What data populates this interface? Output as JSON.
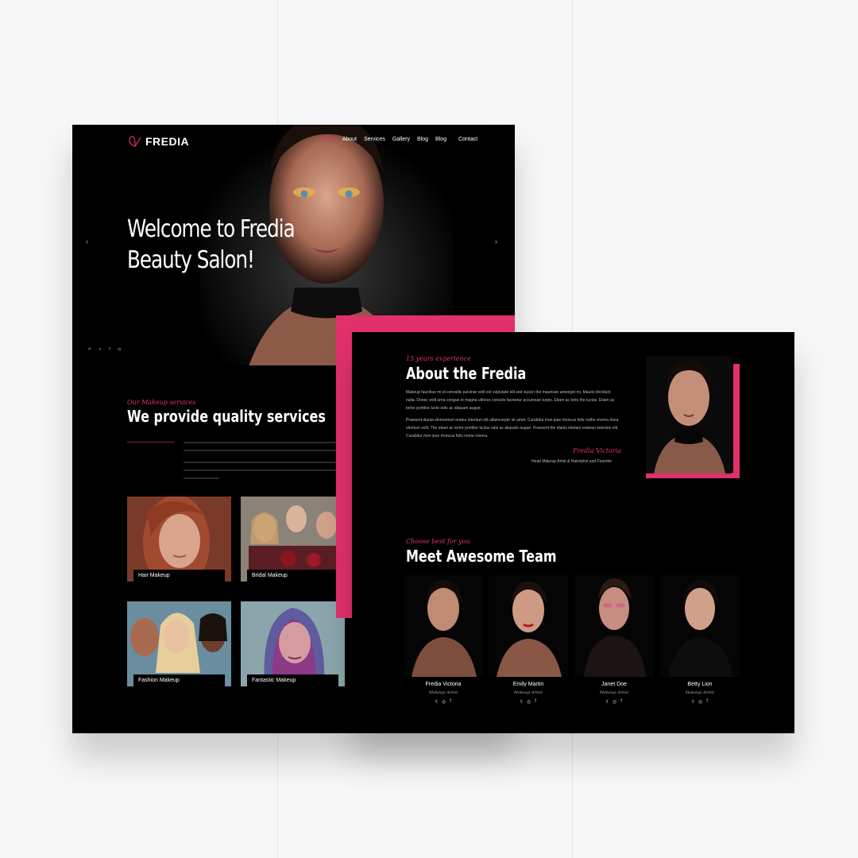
{
  "brand": {
    "name": "FREDIA",
    "accent": "#e2306b"
  },
  "nav": {
    "items": [
      "Home",
      "About",
      "Services",
      "Gallery",
      "Blog",
      "Blog",
      "Contact"
    ],
    "active": "Home"
  },
  "hero": {
    "title_line1": "Welcome to Fredia",
    "title_line2": "Beauty Salon!",
    "prev_icon": "‹",
    "next_icon": "›",
    "social_icons": [
      "pinterest-icon",
      "vimeo-icon",
      "facebook-icon",
      "instagram-icon"
    ]
  },
  "services": {
    "kicker": "Our Makeup services",
    "title": "We provide quality services",
    "cards": [
      {
        "label": "Hair Makeup"
      },
      {
        "label": "Bridal Makeup"
      },
      {
        "label": "Fashion Makeup"
      },
      {
        "label": "Fantastic Makeup"
      }
    ]
  },
  "about": {
    "kicker": "15 years experience",
    "title": "About the Fredia",
    "paragraph1": "Makeup faucibus mi id convallis pulvinar velit est vulputate elit sed suscin the maurisan anteeget mi. Mauris tincidunt nulla. Donec velit urna congue et magna ultrices console facinetur accumsan turpis. Etiam ac torto the luctus. Etiam ac tortor porttitor lucte odio ac aliquam augue.",
    "paragraph2": "Praesent diania elementum erateu interdun elit ullamcorper sit amet. Curabitur mon ipse rhoncus felis nothe viverra dona elentum velit. The etiam ac tortor porttitor luctus odio ac aliquam augue. Praesent the dianis elemen erateun interdun elit. Curabitur mon ipse rhoncus felis nonte viverra.",
    "signature": "Fredia Victoria",
    "role": "Head Makeup Artist & Hairstylist and Founder"
  },
  "team": {
    "kicker": "Choose best for you",
    "title": "Meet Awesome Team",
    "members": [
      {
        "name": "Fredia Victoria",
        "role": "Makeup Artist"
      },
      {
        "name": "Emily Martin",
        "role": "Makeup Artist"
      },
      {
        "name": "Janet Doe",
        "role": "Makeup Artist"
      },
      {
        "name": "Betty Lion",
        "role": "Makeup Artist"
      }
    ]
  }
}
